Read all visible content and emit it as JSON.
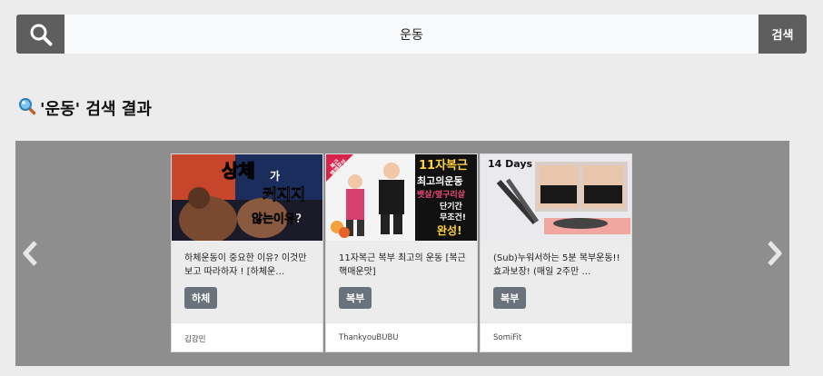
{
  "search": {
    "query": "운동",
    "button_label": "검색"
  },
  "results": {
    "title": "'운동' 검색 결과"
  },
  "cards": [
    {
      "title": "하체운동이 중요한 이유? 이것만 보고 따라하자 ! [하체운…",
      "tag": "하체",
      "channel": "김강민",
      "thumb_text": [
        "상체",
        "가",
        "커지지",
        "않는이유?"
      ]
    },
    {
      "title": "11자복근 복부 최고의 운동 [복근 핵매운맛]",
      "tag": "복부",
      "channel": "ThankyouBUBU",
      "thumb_text": [
        "11자복근",
        "최고의운동",
        "뱃살/옆구리살",
        "단기간",
        "무조건!",
        "완성!",
        "복근",
        "핵매운맛"
      ]
    },
    {
      "title": "(Sub)누워서하는 5분 복부운동!! 효과보장! (매일 2주만 …",
      "tag": "복부",
      "channel": "SomiFit",
      "thumb_text": [
        "14 Days"
      ]
    }
  ],
  "colors": {
    "dark_gray": "#5e5e5e",
    "carousel_bg": "#8e8e8e",
    "tag_bg": "#6a737b",
    "page_bg": "#ececec"
  }
}
